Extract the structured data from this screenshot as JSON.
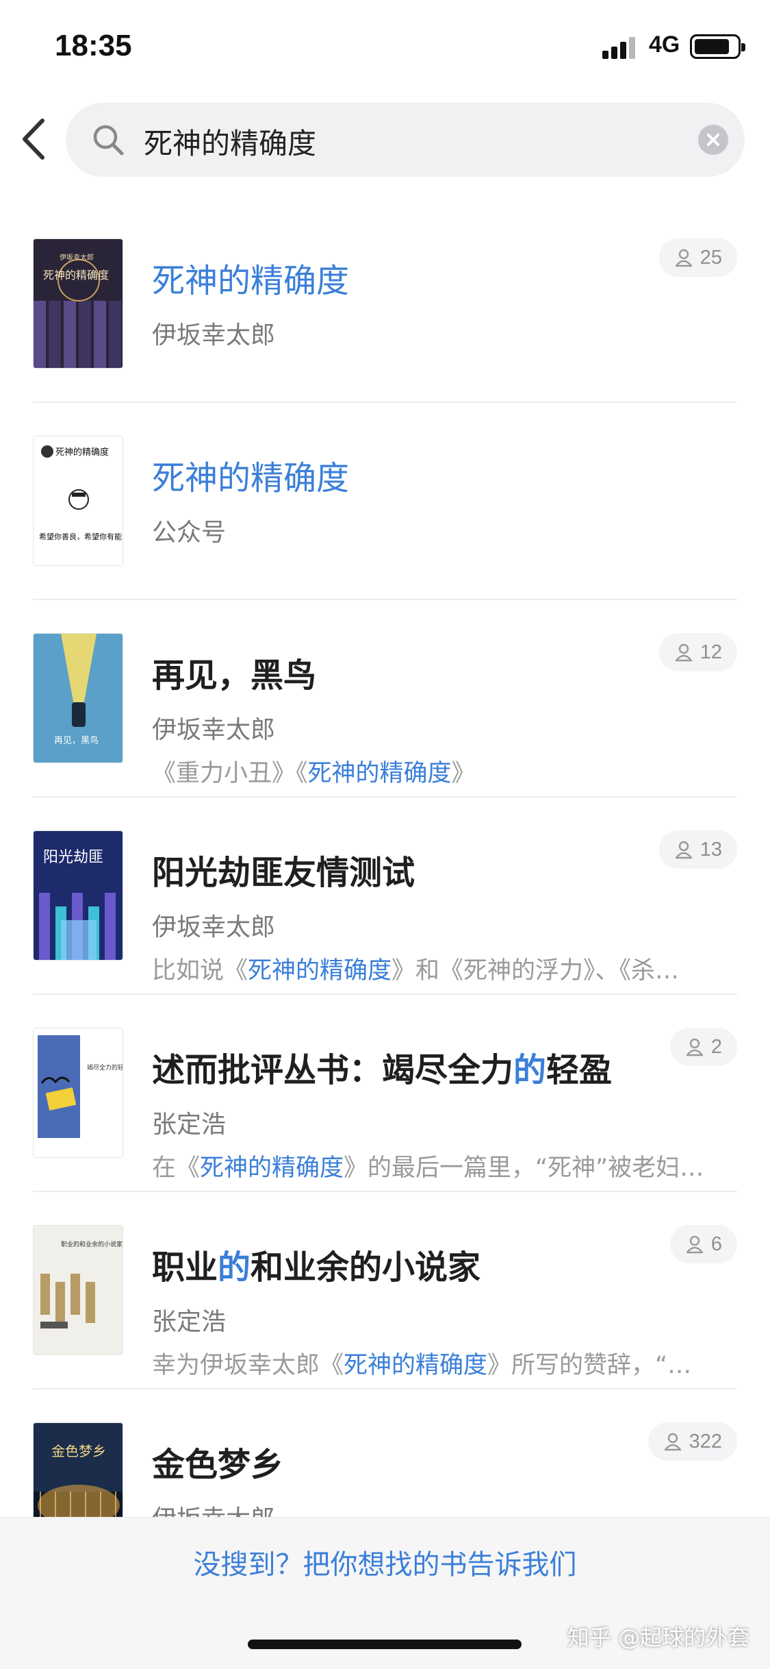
{
  "status_bar": {
    "time": "18:35",
    "network": "4G"
  },
  "search": {
    "query": "死神的精确度"
  },
  "results": [
    {
      "title": "死神的精确度",
      "title_style": "blue",
      "author": "伊坂幸太郎",
      "desc": "",
      "readers": "25",
      "cover": {
        "bg": "#2a2438",
        "accent": "#c9a35a",
        "text1": "伊坂幸太郎",
        "text2": "死神的精确度"
      }
    },
    {
      "title": "死神的精确度",
      "title_style": "blue",
      "author": "公众号",
      "desc": "",
      "readers": "",
      "cover": {
        "bg": "#ffffff",
        "text1": "死神的精确度",
        "text2": "希望你善良，希望你有能力"
      }
    },
    {
      "title": "再见，黑鸟",
      "author": "伊坂幸太郎",
      "desc_parts": [
        "《重力小丑》《",
        "死神的精确度",
        "》"
      ],
      "readers": "12",
      "cover": {
        "bg": "#5aa0c8",
        "accent": "#f3dd6a",
        "text1": "再见，黑鸟"
      }
    },
    {
      "title": "阳光劫匪友情测试",
      "author": "伊坂幸太郎",
      "desc_parts": [
        "比如说《",
        "死神的精确度",
        "》和《死神的浮力》、《杀…"
      ],
      "readers": "13",
      "cover": {
        "bg": "#1d2a6b",
        "accent": "#58c0e0",
        "text1": "阳光劫匪"
      }
    },
    {
      "title_parts": [
        "述而批评丛书：竭尽全力",
        "的",
        "轻盈"
      ],
      "author": "张定浩",
      "desc_parts": [
        "在《",
        "死神的精确度",
        "》的最后一篇里，“死神”被老妇…"
      ],
      "readers": "2",
      "cover": {
        "bg": "#ffffff",
        "accent": "#4a6bb5",
        "text1": "竭尽全力的轻盈"
      }
    },
    {
      "title_parts": [
        "职业",
        "的",
        "和业余的小说家"
      ],
      "author": "张定浩",
      "desc_parts": [
        "幸为伊坂幸太郎《",
        "死神的精确度",
        "》所写的赞辞，“…"
      ],
      "readers": "6",
      "cover": {
        "bg": "#f1efe9",
        "accent": "#b89c66",
        "text1": "职业的和业余的小说家"
      }
    },
    {
      "title": "金色梦乡",
      "author": "伊坂幸太郎",
      "desc": "",
      "readers": "322",
      "cover": {
        "bg": "#1b2d4a",
        "accent": "#e8a83b",
        "text1": "金色梦乡"
      }
    }
  ],
  "bottom": {
    "request_text": "没搜到？把你想找的书告诉我们",
    "watermark": "知乎 @起球的外套"
  },
  "colors": {
    "accent_blue": "#3b7fd8",
    "muted_gray": "#9a9a9a"
  },
  "icons": {
    "back": "chevron-left-icon",
    "search": "search-icon",
    "clear": "clear-icon",
    "readers": "person-icon"
  }
}
